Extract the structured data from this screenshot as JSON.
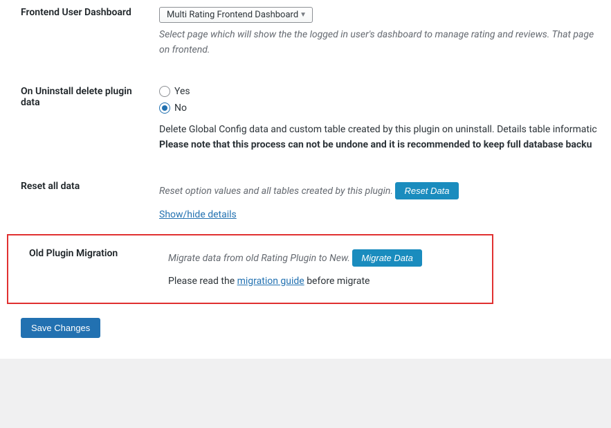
{
  "dashboard": {
    "label": "Frontend User Dashboard",
    "select_value": "Multi Rating Frontend Dashboard",
    "description": "Select page which will show the the logged in user's dashboard to manage rating and reviews. That page on frontend."
  },
  "uninstall": {
    "label": "On Uninstall delete plugin data",
    "yes": "Yes",
    "no": "No",
    "description": "Delete Global Config data and custom table created by this plugin on uninstall. Details table informatic",
    "warning": "Please note that this process can not be undone and it is recommended to keep full database backu"
  },
  "reset": {
    "label": "Reset all data",
    "description": "Reset option values and all tables created by this plugin.",
    "button": "Reset Data",
    "toggle_link": "Show/hide details"
  },
  "migration": {
    "label": "Old Plugin Migration",
    "description": "Migrate data from old Rating Plugin to New.",
    "button": "Migrate Data",
    "note_prefix": "Please read the ",
    "note_link": "migration guide",
    "note_suffix": " before migrate"
  },
  "submit": {
    "label": "Save Changes"
  }
}
